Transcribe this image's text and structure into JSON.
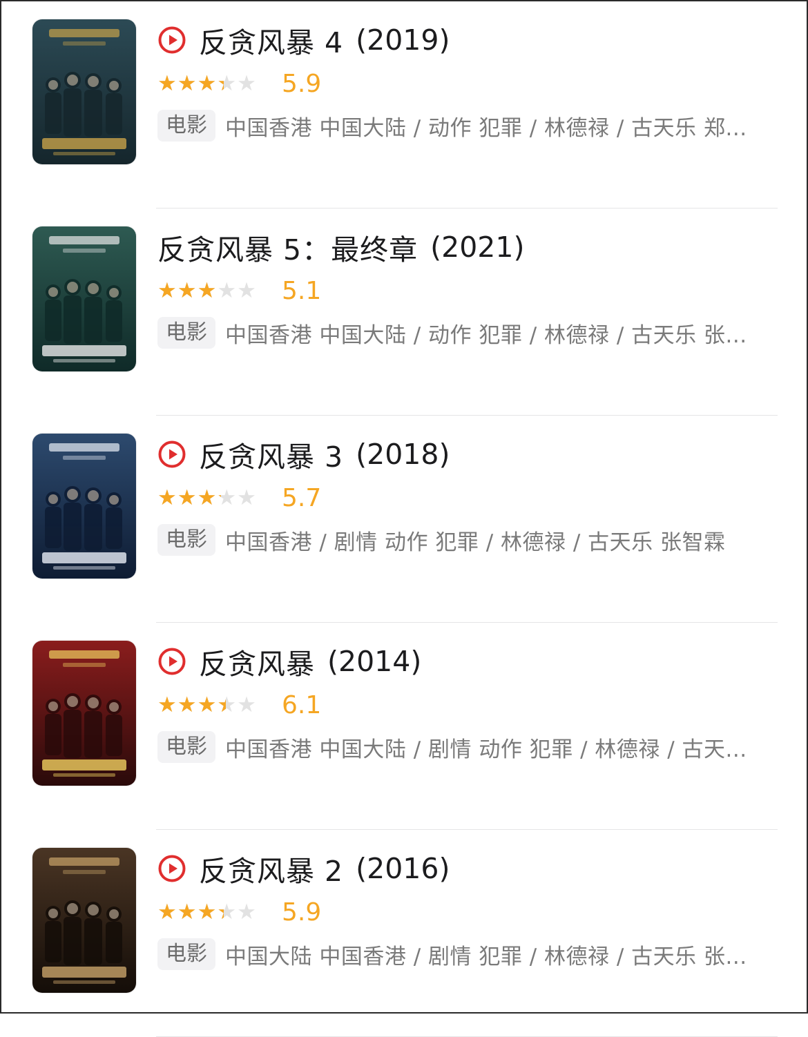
{
  "movies": [
    {
      "title": "反贪风暴 4",
      "year": "(2019)",
      "has_play": true,
      "rating": 5.9,
      "rating_text": "5.9",
      "badge": "电影",
      "meta": "中国香港 中国大陆 / 动作 犯罪 / 林德禄 / 古天乐 郑...",
      "poster_colors": [
        "#2c4a55",
        "#15262c",
        "#c8a24a"
      ]
    },
    {
      "title": "反贪风暴 5：最终章",
      "year": "(2021)",
      "has_play": false,
      "rating": 5.1,
      "rating_text": "5.1",
      "badge": "电影",
      "meta": "中国香港 中国大陆 / 动作 犯罪 / 林德禄 / 古天乐 张...",
      "poster_colors": [
        "#2e5a52",
        "#0f2a28",
        "#e8e8e8"
      ]
    },
    {
      "title": "反贪风暴 3",
      "year": "(2018)",
      "has_play": true,
      "rating": 5.7,
      "rating_text": "5.7",
      "badge": "电影",
      "meta": "中国香港 / 剧情 动作 犯罪 / 林德禄 / 古天乐 张智霖",
      "poster_colors": [
        "#2d4a6e",
        "#0e1c33",
        "#e8eef6"
      ]
    },
    {
      "title": "反贪风暴",
      "year": "(2014)",
      "has_play": true,
      "rating": 6.1,
      "rating_text": "6.1",
      "badge": "电影",
      "meta": "中国香港 中国大陆 / 剧情 动作 犯罪 / 林德禄 / 古天...",
      "poster_colors": [
        "#8a1d1d",
        "#2a0a0a",
        "#f0d060"
      ]
    },
    {
      "title": "反贪风暴 2",
      "year": "(2016)",
      "has_play": true,
      "rating": 5.9,
      "rating_text": "5.9",
      "badge": "电影",
      "meta": "中国大陆 中国香港 / 剧情 犯罪 / 林德禄 / 古天乐 张...",
      "poster_colors": [
        "#4a3524",
        "#140d08",
        "#c9a46a"
      ]
    }
  ],
  "colors": {
    "accent_star": "#f5a623",
    "play_red": "#e02e2e",
    "title_text": "#1c1c1e",
    "meta_text": "#7a7a7a"
  },
  "icons": {
    "play": "play-circle-icon",
    "star": "star-icon"
  }
}
